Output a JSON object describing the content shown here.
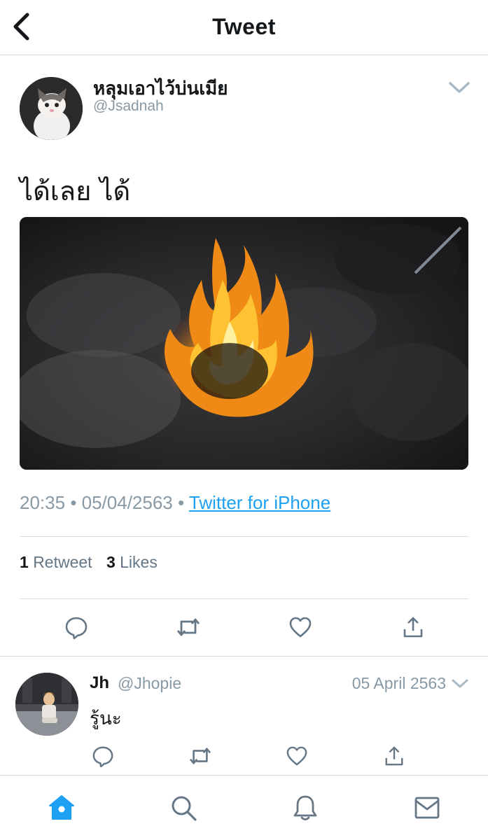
{
  "header": {
    "title": "Tweet"
  },
  "tweet": {
    "display_name": "หลุมเอาไว้บ่นเมีย",
    "handle": "@Jsadnah",
    "text": "ได้เลย ได้",
    "time": "20:35",
    "date": "05/04/2563",
    "source": "Twitter for iPhone",
    "retweet_count": "1",
    "retweet_label": "Retweet",
    "like_count": "3",
    "like_label": "Likes"
  },
  "reply": {
    "display_name": "Jh",
    "handle": "@Jhopie",
    "date": "05 April 2563",
    "text": "รู้นะ"
  },
  "colors": {
    "accent": "#1da1f2",
    "muted": "#8899a6",
    "icon": "#657786",
    "divider": "#d8dde2"
  },
  "icons": {
    "back": "chevron-left-icon",
    "caret": "chevron-down-icon",
    "reply": "comment-bubble-icon",
    "retweet": "retweet-icon",
    "like": "heart-icon",
    "share": "share-icon",
    "home": "home-icon",
    "search": "search-icon",
    "notifications": "bell-icon",
    "messages": "envelope-icon"
  }
}
